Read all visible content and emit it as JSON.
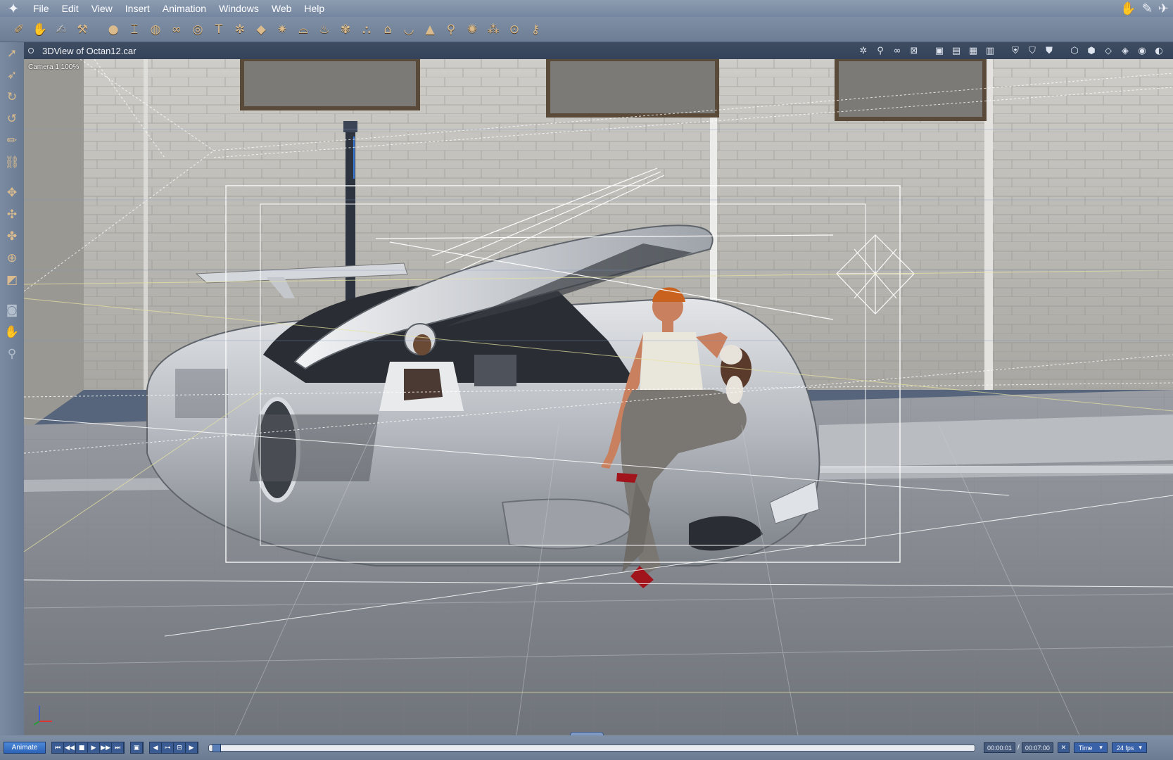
{
  "menubar": {
    "items": [
      "File",
      "Edit",
      "View",
      "Insert",
      "Animation",
      "Windows",
      "Web",
      "Help"
    ],
    "mode_icons": [
      "hand-mode-icon",
      "sculpt-mode-icon",
      "render-mode-icon"
    ]
  },
  "toolbar": {
    "tools": [
      "pen-tool-icon",
      "hand-tool-icon",
      "brush-tool-icon",
      "hammer-tool-icon",
      "sphere-icon",
      "i-beam-icon",
      "globe-icon",
      "chain-icon",
      "donut-icon",
      "text-icon",
      "gear-icon",
      "plane-icon",
      "burst-icon",
      "cap-icon",
      "flame-icon",
      "knot-icon",
      "lamp-icon",
      "house-icon",
      "bowl-icon",
      "cone-icon",
      "pin-icon",
      "bug-icon",
      "people-icon",
      "ring-icon",
      "wrench-icon"
    ]
  },
  "lefttools": {
    "tools": [
      "select-icon",
      "direct-select-icon",
      "rotate-icon",
      "sweep-icon",
      "pencil-icon",
      "link-icon",
      "move-icon",
      "move-plane-icon",
      "scale-icon",
      "gizmo-icon",
      "cube-face-icon",
      "camera-icon",
      "pan-hand-icon",
      "zoom-icon"
    ]
  },
  "viewport": {
    "title": "3DView of Octan12.car",
    "camera_label": "Camera 1 100%"
  },
  "timeline": {
    "animate_label": "Animate",
    "current_time": "00:00:01",
    "separator": "/",
    "end_time": "00:07:00",
    "time_mode": "Time",
    "fps": "24 fps",
    "scrub_position": 0.01
  },
  "colors": {
    "accent": "#3a62a8",
    "selection_box": "#ffffff",
    "ground_grid": "#aeb6c2"
  }
}
